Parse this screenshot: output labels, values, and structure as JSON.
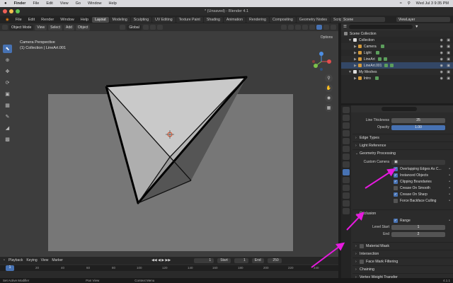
{
  "mac_menu": {
    "apple": "",
    "app": "Blender",
    "items": [
      "Finder",
      "File",
      "Edit",
      "View",
      "Go",
      "Window",
      "Help"
    ],
    "clock": "Wed Jul 3  9:35 PM"
  },
  "title": "* (Unsaved) - Blender 4.1",
  "topbar": {
    "menus": [
      "File",
      "Edit",
      "Render",
      "Window",
      "Help"
    ],
    "workspaces": [
      "Layout",
      "Modeling",
      "Sculpting",
      "UV Editing",
      "Texture Paint",
      "Shading",
      "Animation",
      "Rendering",
      "Compositing",
      "Geometry Nodes",
      "Scripting"
    ],
    "active_workspace": "Layout",
    "scene": "Scene",
    "view_layer": "ViewLayer"
  },
  "viewport": {
    "mode": "Object Mode",
    "menus": [
      "View",
      "Select",
      "Add",
      "Object"
    ],
    "orientation": "Global",
    "options": "Options",
    "line1": "Camera Perspective",
    "line2": "(1) Collection | LineArt.001"
  },
  "timeline": {
    "menus": [
      "Playback",
      "Keying",
      "View",
      "Marker"
    ],
    "current_frame": "1",
    "start_label": "Start",
    "start": "1",
    "end_label": "End",
    "end": "250",
    "ticks": [
      "1",
      "20",
      "40",
      "60",
      "80",
      "100",
      "120",
      "140",
      "160",
      "180",
      "200",
      "220",
      "240"
    ]
  },
  "status": {
    "left": "Set Active Modifier",
    "mid1": "Pan View",
    "mid2": "Context Menu",
    "version": "4.1.1"
  },
  "outliner": {
    "rows": [
      {
        "label": "Scene Collection",
        "indent": 0
      },
      {
        "label": "Collection",
        "indent": 1
      },
      {
        "label": "Camera",
        "indent": 2
      },
      {
        "label": "Light",
        "indent": 2
      },
      {
        "label": "LineArt",
        "indent": 2
      },
      {
        "label": "LineArt.001",
        "indent": 2
      },
      {
        "label": "My Meshes",
        "indent": 1
      },
      {
        "label": "Intro",
        "indent": 2
      }
    ]
  },
  "props": {
    "line_thickness_label": "Line Thickness",
    "line_thickness": "25",
    "opacity_label": "Opacity",
    "opacity": "1.00",
    "sections": {
      "edge_types": "Edge Types",
      "light_reference": "Light Reference",
      "geometry_processing": "Geometry Processing",
      "occlusion": "Occlusion",
      "material_mask": "Material Mask",
      "intersection": "Intersection",
      "face_mark": "Face Mark Filtering",
      "chaining": "Chaining",
      "vertex_weight": "Vertex Weight Transfer"
    },
    "custom_camera_label": "Custom Camera",
    "geo_checks": [
      {
        "label": "Overlapping Edges As C...",
        "on": true
      },
      {
        "label": "Instanced Objects",
        "on": true
      },
      {
        "label": "Clipping Boundaries",
        "on": true
      },
      {
        "label": "Crease On Smooth",
        "on": false
      },
      {
        "label": "Crease On Sharp",
        "on": true
      },
      {
        "label": "Force Backface Culling",
        "on": false
      }
    ],
    "range_label": "Range",
    "level_start_label": "Level Start",
    "level_start": "1",
    "end_label": "End",
    "end": "2"
  },
  "colors": {
    "accent": "#4772b3",
    "annotation": "#e61adf"
  }
}
